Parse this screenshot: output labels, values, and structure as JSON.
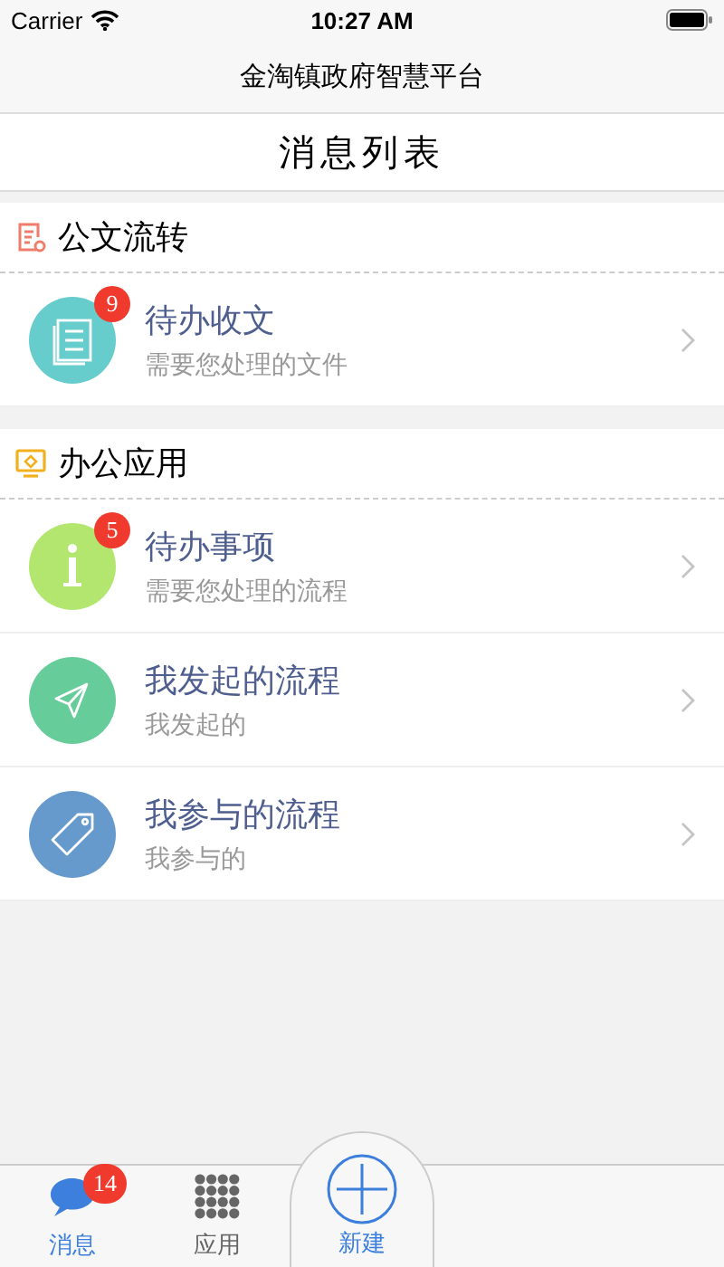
{
  "status_bar": {
    "carrier": "Carrier",
    "time": "10:27 AM"
  },
  "nav": {
    "title": "金淘镇政府智慧平台"
  },
  "page_title": "消息列表",
  "sections": [
    {
      "title": "公文流转",
      "kind": "document",
      "items": [
        {
          "title": "待办收文",
          "subtitle": "需要您处理的文件",
          "kind": "document",
          "color": "#66cccc",
          "badge": "9"
        }
      ]
    },
    {
      "title": "办公应用",
      "kind": "monitor",
      "items": [
        {
          "title": "待办事项",
          "subtitle": "需要您处理的流程",
          "kind": "info",
          "color": "#b3e66e",
          "badge": "5"
        },
        {
          "title": "我发起的流程",
          "subtitle": "我发起的",
          "kind": "send",
          "color": "#66cc99"
        },
        {
          "title": "我参与的流程",
          "subtitle": "我参与的",
          "kind": "tag",
          "color": "#6699cc"
        }
      ]
    }
  ],
  "tabs": [
    {
      "label": "消息",
      "kind": "chat",
      "badge": "14",
      "selected": true
    },
    {
      "label": "应用",
      "kind": "grid",
      "selected": false
    },
    {
      "label": "新建",
      "kind": "plus",
      "selected": false
    }
  ]
}
